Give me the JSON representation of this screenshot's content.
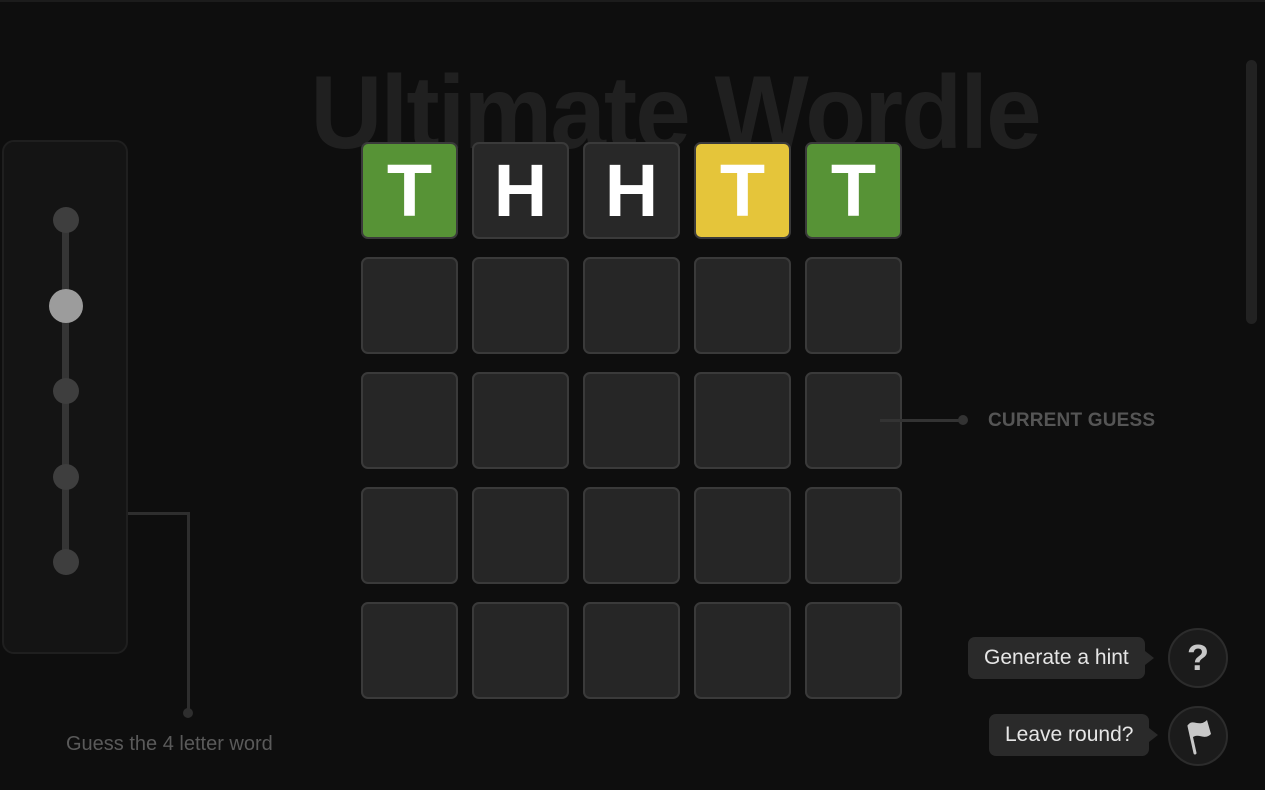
{
  "title": "Ultimate Wordle",
  "instruction": "Guess the 4 letter word",
  "current_guess_label": "CURRENT GUESS",
  "slider": {
    "stops": 5,
    "selected_index": 1
  },
  "board": {
    "rows": [
      [
        {
          "letter": "T",
          "state": "correct"
        },
        {
          "letter": "H",
          "state": "absent"
        },
        {
          "letter": "H",
          "state": "absent"
        },
        {
          "letter": "T",
          "state": "present"
        },
        {
          "letter": "T",
          "state": "correct"
        }
      ],
      [
        {
          "letter": "",
          "state": "empty"
        },
        {
          "letter": "",
          "state": "empty"
        },
        {
          "letter": "",
          "state": "empty"
        },
        {
          "letter": "",
          "state": "empty"
        },
        {
          "letter": "",
          "state": "empty"
        }
      ],
      [
        {
          "letter": "",
          "state": "empty"
        },
        {
          "letter": "",
          "state": "empty"
        },
        {
          "letter": "",
          "state": "empty"
        },
        {
          "letter": "",
          "state": "empty"
        },
        {
          "letter": "",
          "state": "empty"
        }
      ],
      [
        {
          "letter": "",
          "state": "empty"
        },
        {
          "letter": "",
          "state": "empty"
        },
        {
          "letter": "",
          "state": "empty"
        },
        {
          "letter": "",
          "state": "empty"
        },
        {
          "letter": "",
          "state": "empty"
        }
      ],
      [
        {
          "letter": "",
          "state": "empty"
        },
        {
          "letter": "",
          "state": "empty"
        },
        {
          "letter": "",
          "state": "empty"
        },
        {
          "letter": "",
          "state": "empty"
        },
        {
          "letter": "",
          "state": "empty"
        }
      ]
    ]
  },
  "actions": {
    "hint_label": "Generate a hint",
    "hint_icon": "question-mark-icon",
    "hint_glyph": "?",
    "leave_label": "Leave round?",
    "leave_icon": "flag-icon"
  },
  "colors": {
    "background": "#0e0e0e",
    "correct": "#579336",
    "present": "#e5c53a",
    "absent": "#282828",
    "empty_tile": "#262626",
    "tile_border": "#3a3a3a"
  }
}
